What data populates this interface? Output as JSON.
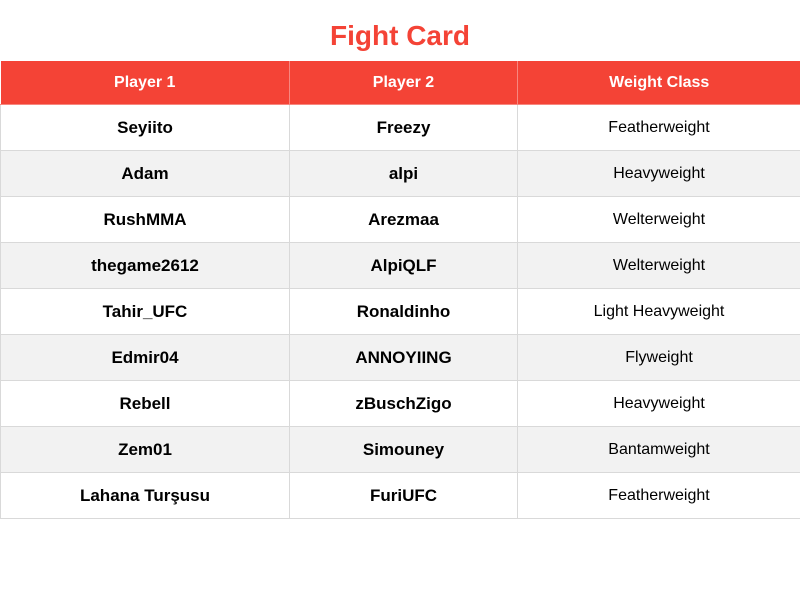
{
  "title": "Fight Card",
  "colors": {
    "accent": "#f44336",
    "header_text": "#ffffff",
    "row_alt": "#f2f2f2",
    "grid": "#d9d9d9"
  },
  "table": {
    "headers": [
      "Player 1",
      "Player 2",
      "Weight Class"
    ],
    "rows": [
      [
        "Seyiito",
        "Freezy",
        "Featherweight"
      ],
      [
        "Adam",
        "alpi",
        "Heavyweight"
      ],
      [
        "RushMMA",
        "Arezmaa",
        "Welterweight"
      ],
      [
        "thegame2612",
        "AlpiQLF",
        "Welterweight"
      ],
      [
        "Tahir_UFC",
        "Ronaldinho",
        "Light Heavyweight"
      ],
      [
        "Edmir04",
        "ANNOYIING",
        "Flyweight"
      ],
      [
        "Rebell",
        "zBuschZigo",
        "Heavyweight"
      ],
      [
        "Zem01",
        "Simouney",
        "Bantamweight"
      ],
      [
        "Lahana Turşusu",
        "FuriUFC",
        "Featherweight"
      ]
    ]
  }
}
